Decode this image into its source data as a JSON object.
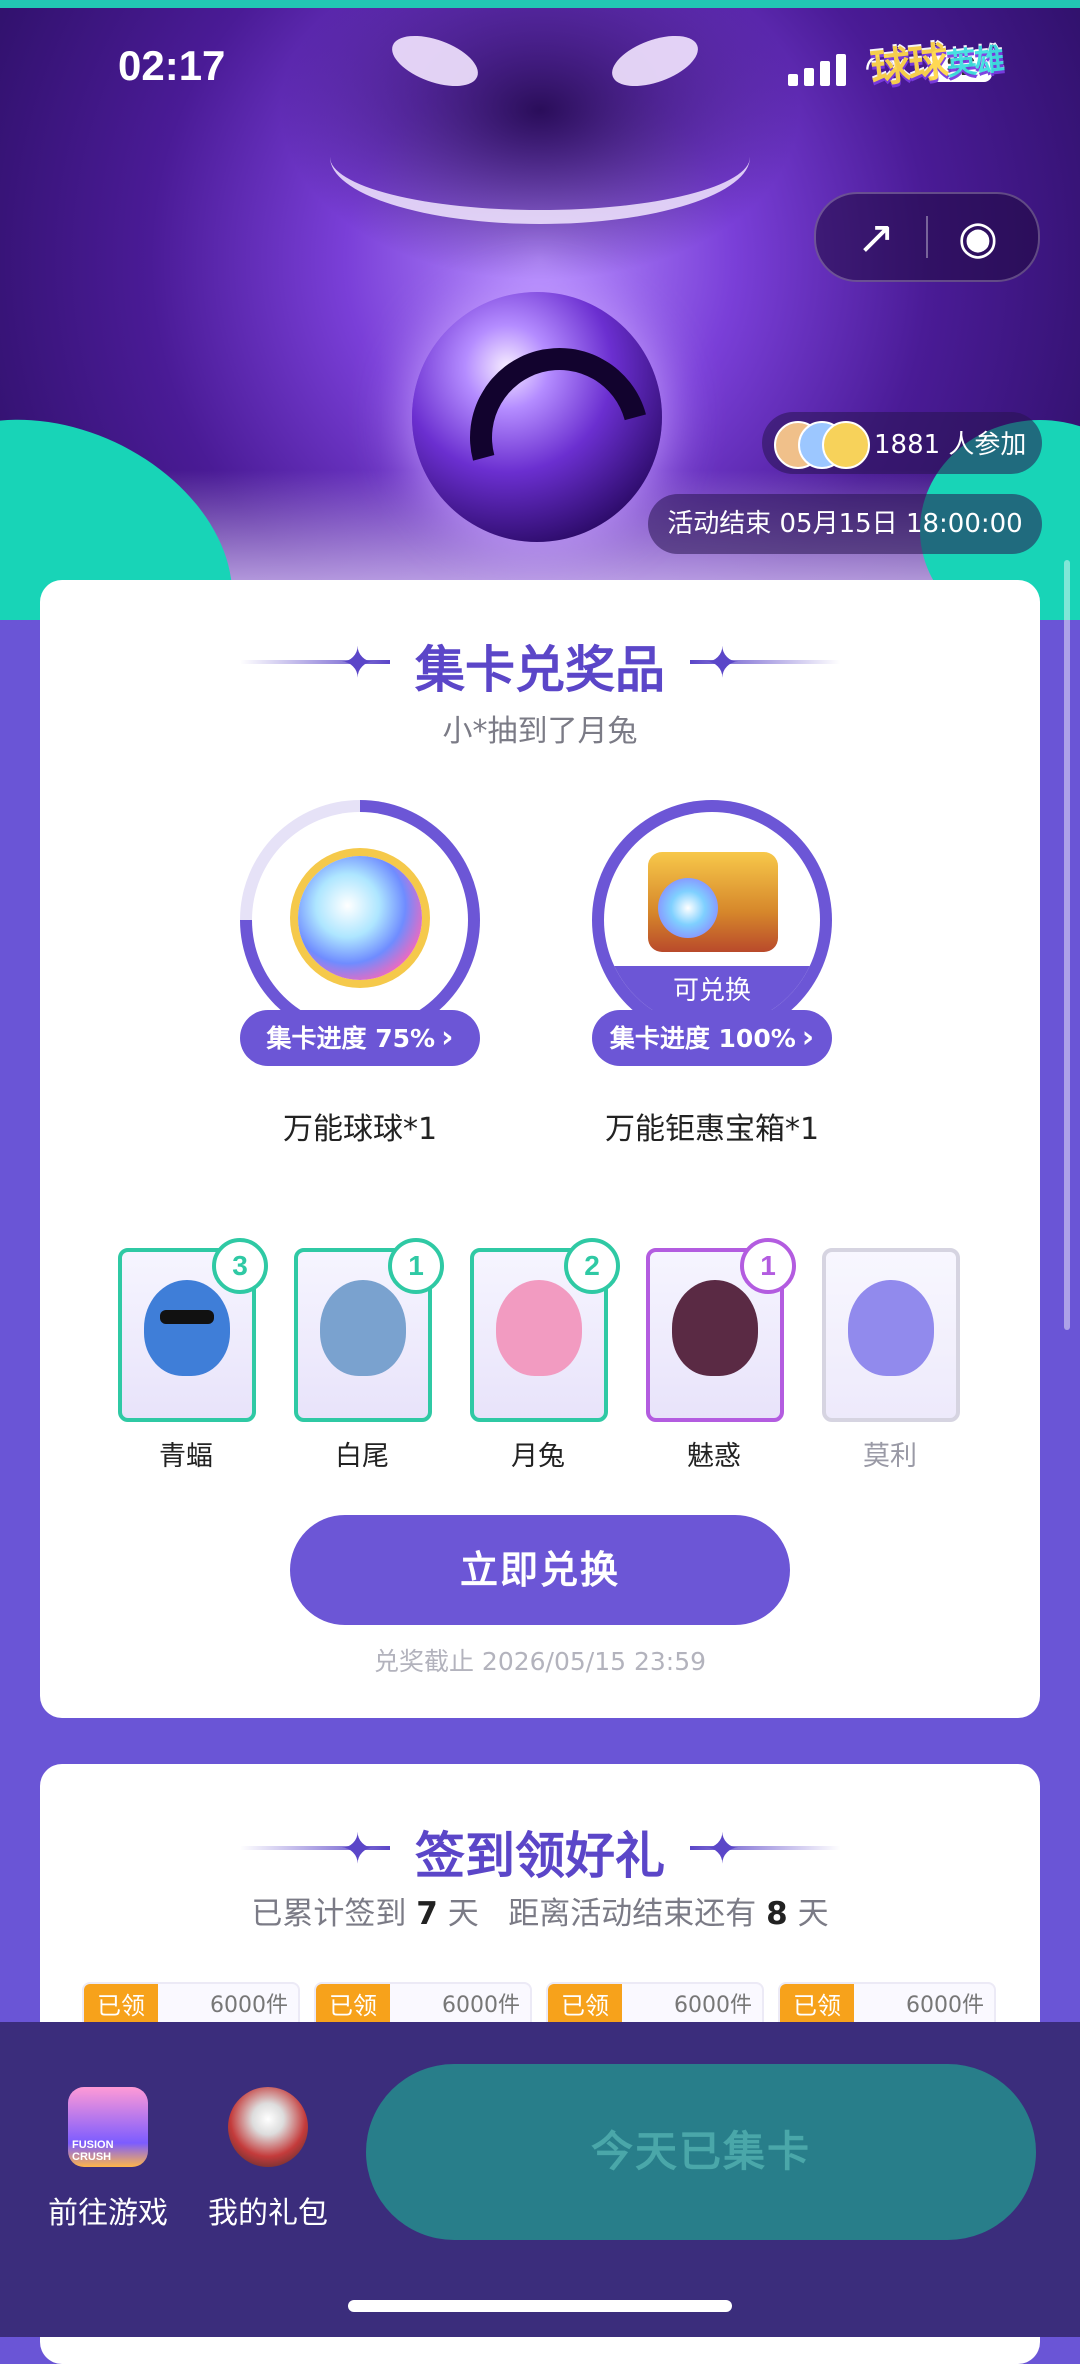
{
  "status_bar": {
    "time": "02:17",
    "battery": "82"
  },
  "hero": {
    "logo_text": "球球",
    "logo_sub": "英雄",
    "participants": "1881 人参加",
    "end_time": "活动结束 05月15日 18:00:00"
  },
  "collect": {
    "title": "集卡兑奖品",
    "winner_text": "小*抽到了月兔",
    "prizes": [
      {
        "progress_label": "集卡进度 75%",
        "progress": 0.75,
        "name": "万能球球*1",
        "redeemable": ""
      },
      {
        "progress_label": "集卡进度 100%",
        "progress": 1.0,
        "name": "万能钜惠宝箱*1",
        "redeemable": "可兑换"
      }
    ],
    "cards": [
      {
        "name": "青蝠",
        "count": "3",
        "color": "#2fc9a4"
      },
      {
        "name": "白尾",
        "count": "1",
        "color": "#2fc9a4"
      },
      {
        "name": "月兔",
        "count": "2",
        "color": "#2fc9a4"
      },
      {
        "name": "魅惑",
        "count": "1",
        "color": "#b35ce0"
      },
      {
        "name": "莫利",
        "count": "",
        "color": "#c9c6d8"
      }
    ],
    "redeem_button": "立即兑换",
    "deadline": "兑奖截止 2026/05/15 23:59"
  },
  "signin": {
    "title": "签到领好礼",
    "summary_prefix": "已累计签到 ",
    "days_signed": "7",
    "summary_mid": " 天   距离活动结束还有 ",
    "days_left": "8",
    "summary_suffix": " 天",
    "rewards": [
      {
        "status": "已领",
        "qty": "6000件"
      },
      {
        "status": "已领",
        "qty": "6000件"
      },
      {
        "status": "已领",
        "qty": "6000件"
      },
      {
        "status": "已领",
        "qty": "6000件"
      }
    ]
  },
  "bottom_bar": {
    "go_game": "前往游戏",
    "go_game_icon_text": "FUSION CRUSH",
    "my_gift": "我的礼包",
    "collected_button": "今天已集卡"
  },
  "colors": {
    "accent": "#6c56d6",
    "teal": "#2fc9a4",
    "orange": "#f7a21b",
    "bottom": "#3b2d7c"
  }
}
